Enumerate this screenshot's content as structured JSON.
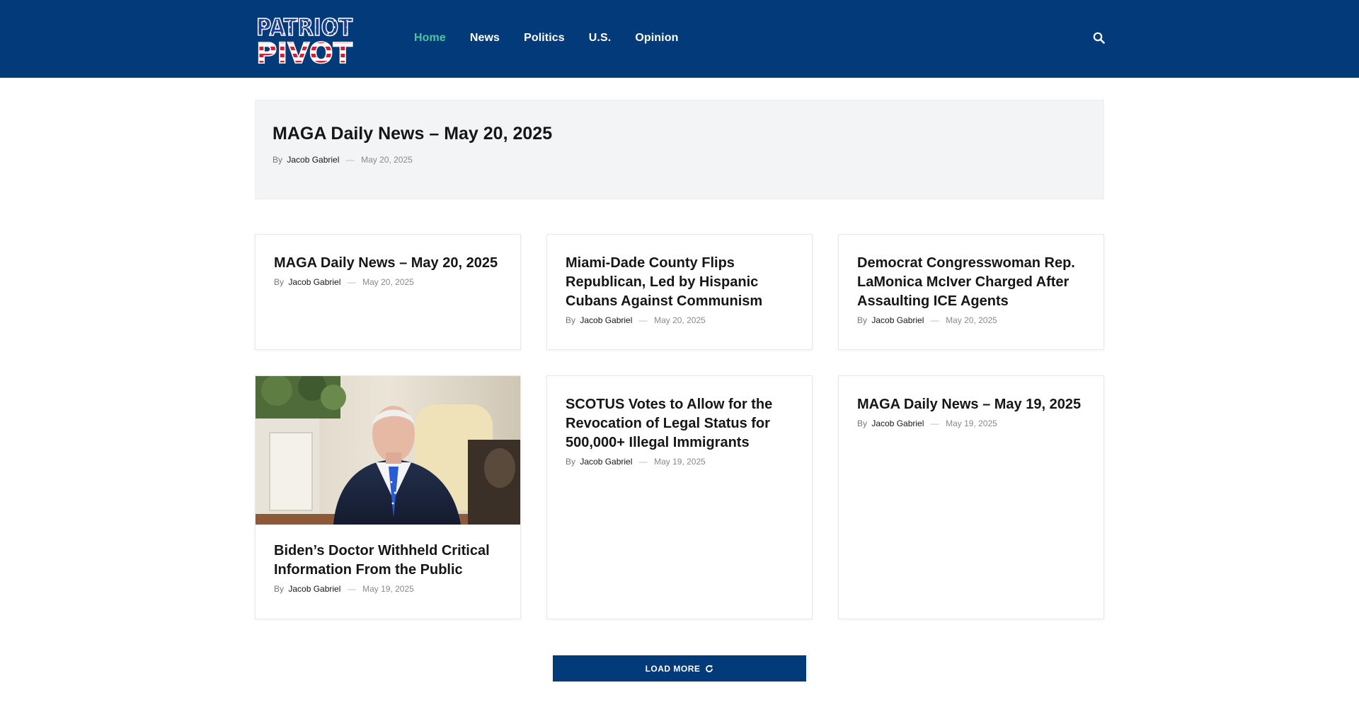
{
  "header": {
    "logo_line1": "PATRIOT",
    "logo_line2": "PIVOT",
    "nav": [
      {
        "label": "Home",
        "active": true
      },
      {
        "label": "News"
      },
      {
        "label": "Politics"
      },
      {
        "label": "U.S."
      },
      {
        "label": "Opinion"
      }
    ],
    "search_icon": "search-icon"
  },
  "hero": {
    "title": "MAGA Daily News – May 20, 2025",
    "by": "By",
    "author": "Jacob Gabriel",
    "sep": "—",
    "date": "May 20, 2025"
  },
  "cards": [
    {
      "title": "MAGA Daily News – May 20, 2025",
      "by": "By",
      "author": "Jacob Gabriel",
      "sep": "—",
      "date": "May 20, 2025"
    },
    {
      "title": "Miami-Dade County Flips Republican, Led by Hispanic Cubans Against Communism",
      "by": "By",
      "author": "Jacob Gabriel",
      "sep": "—",
      "date": "May 20, 2025"
    },
    {
      "title": "Democrat Congresswoman Rep. LaMonica McIver Charged After Assaulting ICE Agents",
      "by": "By",
      "author": "Jacob Gabriel",
      "sep": "—",
      "date": "May 20, 2025"
    },
    {
      "title": "Biden’s Doctor Withheld Critical Information From the Public",
      "by": "By",
      "author": "Jacob Gabriel",
      "sep": "—",
      "date": "May 19, 2025"
    },
    {
      "title": "SCOTUS Votes to Allow for the Revocation of Legal Status for 500,000+ Illegal Immigrants",
      "by": "By",
      "author": "Jacob Gabriel",
      "sep": "—",
      "date": "May 19, 2025"
    },
    {
      "title": "MAGA Daily News – May 19, 2025",
      "by": "By",
      "author": "Jacob Gabriel",
      "sep": "—",
      "date": "May 19, 2025"
    }
  ],
  "load_more": {
    "label": "LOAD MORE",
    "icon": "refresh-icon"
  },
  "colors": {
    "header_bg": "#033a7a",
    "nav_active": "#4fc4a3",
    "button_bg": "#033a7a",
    "hero_bg": "#f3f4f5"
  }
}
